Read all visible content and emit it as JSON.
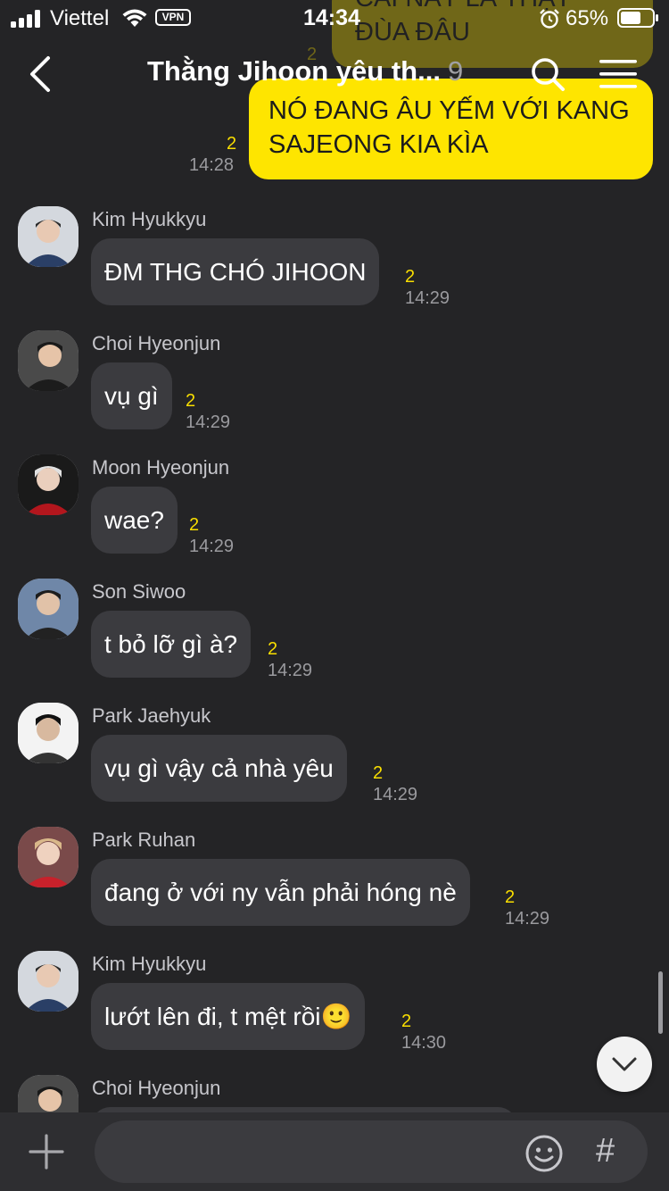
{
  "status_bar": {
    "carrier": "Viettel",
    "vpn": "VPN",
    "time": "14:34",
    "battery": "65%"
  },
  "header": {
    "title": "Thằng Jihoon yêu th...",
    "member_count": "9"
  },
  "top_clipped_message": {
    "line1": "CÁI NÀY LÀ THẬT",
    "line2": "ĐÙA ĐÂU",
    "read_count": "2"
  },
  "outgoing_message": {
    "line1": "NÓ ĐANG ÂU YẾM VỚI KANG",
    "line2": "SAJEONG KIA KÌA",
    "read_count": "2",
    "time": "14:28"
  },
  "messages": [
    {
      "sender": "Kim Hyukkyu",
      "text": "ĐM THG CHÓ JIHOON",
      "read_count": "2",
      "time": "14:29"
    },
    {
      "sender": "Choi Hyeonjun",
      "text": "vụ gì",
      "read_count": "2",
      "time": "14:29"
    },
    {
      "sender": "Moon Hyeonjun",
      "text": "wae?",
      "read_count": "2",
      "time": "14:29"
    },
    {
      "sender": "Son Siwoo",
      "text": "t bỏ lỡ gì à?",
      "read_count": "2",
      "time": "14:29"
    },
    {
      "sender": "Park Jaehyuk",
      "text": "vụ gì vậy cả nhà yêu",
      "read_count": "2",
      "time": "14:29"
    },
    {
      "sender": "Park Ruhan",
      "text": "đang ở với ny vẫn phải hóng nè",
      "read_count": "2",
      "time": "14:29"
    },
    {
      "sender": "Kim Hyukkyu",
      "text": "lướt lên đi, t mệt rồi🙂",
      "read_count": "2",
      "time": "14:30"
    },
    {
      "sender": "Choi Hyeonjun",
      "text": "",
      "read_count": "",
      "time": ""
    }
  ],
  "input": {
    "placeholder": "",
    "hash_label": "#"
  },
  "colors": {
    "background": "#242426",
    "outgoing_bubble": "#fee500",
    "incoming_bubble": "#3b3b3f",
    "read_count": "#f9de00"
  }
}
